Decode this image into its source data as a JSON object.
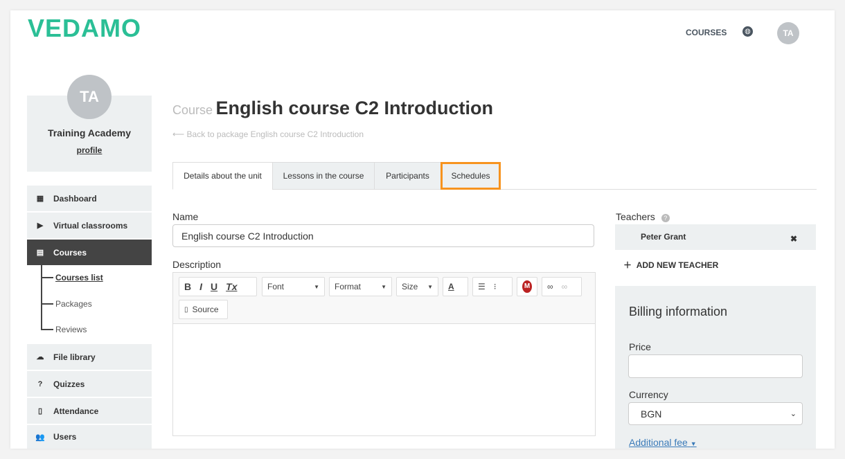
{
  "brand": {
    "logo": "VEDAMO",
    "color": "#2bbf96"
  },
  "topnav": {
    "courses": "COURSES",
    "globe_icon": "globe-icon",
    "avatar": "TA"
  },
  "profile": {
    "avatar": "TA",
    "name": "Training Academy",
    "link": "profile"
  },
  "sidebar": {
    "items": [
      {
        "label": "Dashboard",
        "icon": "▦"
      },
      {
        "label": "Virtual classrooms",
        "icon": "▶"
      },
      {
        "label": "Courses",
        "icon": "▤"
      },
      {
        "label": "File library",
        "icon": "☁"
      },
      {
        "label": "Quizzes",
        "icon": "?"
      },
      {
        "label": "Attendance",
        "icon": "▯"
      },
      {
        "label": "Users",
        "icon": "👥"
      }
    ],
    "sub": [
      "Courses list",
      "Packages",
      "Reviews"
    ]
  },
  "header": {
    "prefix": "Course",
    "title": "English course C2 Introduction",
    "back": "⟵ Back to package English course C2 Introduction"
  },
  "tabs": [
    "Details about the unit",
    "Lessons in the course",
    "Participants",
    "Schedules"
  ],
  "highlight_color": "#f7931e",
  "form": {
    "name_label": "Name",
    "name_value": "English course C2 Introduction",
    "desc_label": "Description"
  },
  "editor": {
    "bold": "B",
    "italic": "I",
    "underline": "U",
    "clear": "Tx",
    "font": "Font",
    "format": "Format",
    "size": "Size",
    "color": "A",
    "source": "Source"
  },
  "teachers": {
    "label": "Teachers",
    "items": [
      "Peter Grant"
    ],
    "add": "ADD NEW TEACHER"
  },
  "billing": {
    "title": "Billing information",
    "price_label": "Price",
    "price_value": "",
    "currency_label": "Currency",
    "currency_value": "BGN",
    "additional": "Additional fee"
  }
}
